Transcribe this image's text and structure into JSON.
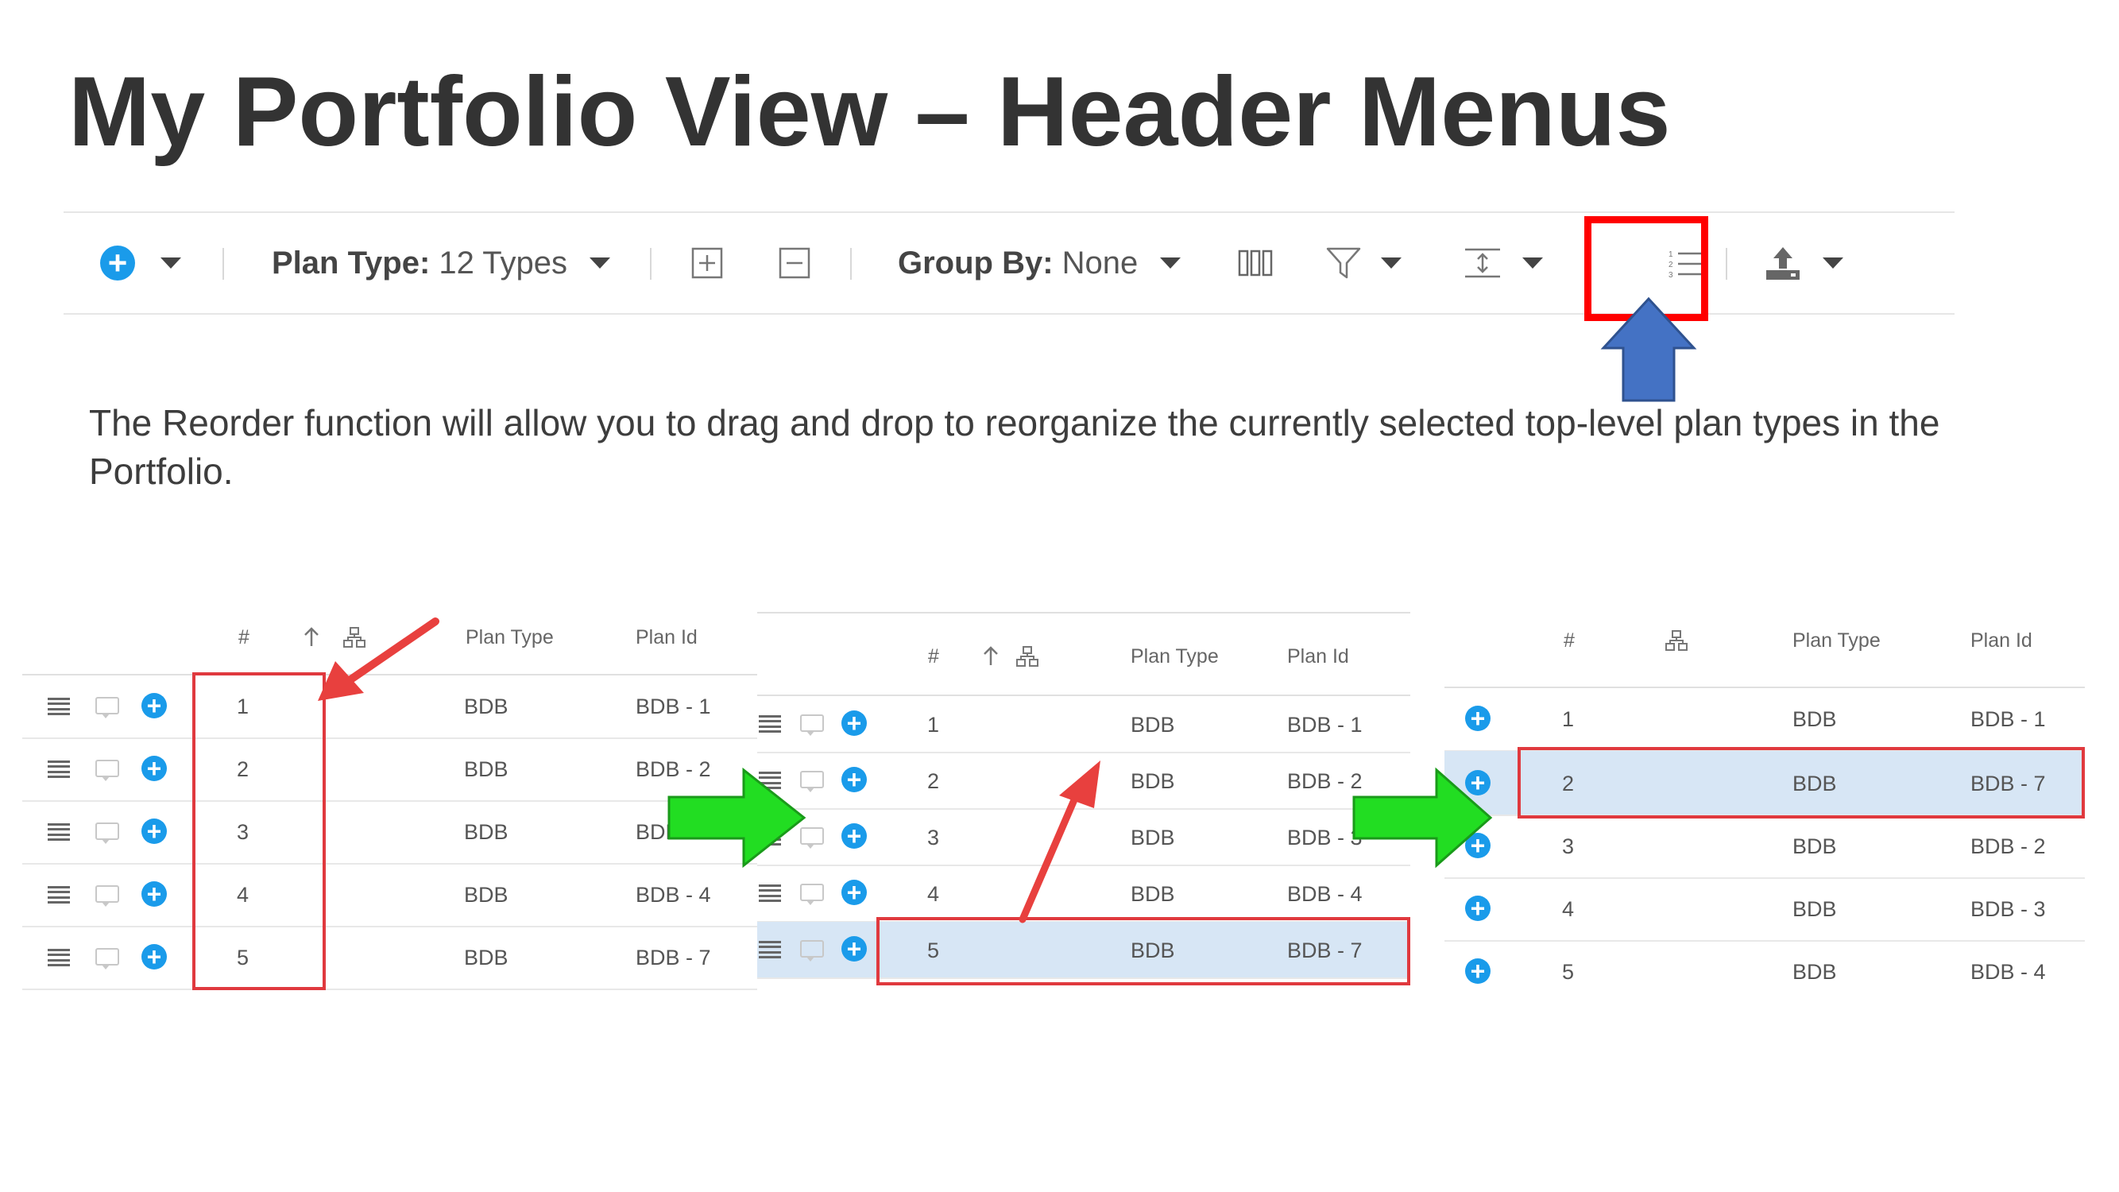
{
  "slide": {
    "title": "My Portfolio View – Header Menus",
    "description": "The Reorder function will allow you to drag and drop to reorganize the currently selected top-level plan types in the Portfolio."
  },
  "toolbar": {
    "plan_type_label": "Plan Type:",
    "plan_type_value": "12 Types",
    "group_by_label": "Group By:",
    "group_by_value": "None",
    "icons": [
      "add-icon",
      "expand-all-icon",
      "collapse-all-icon",
      "columns-icon",
      "filter-icon",
      "row-height-icon",
      "reorder-icon",
      "export-icon"
    ]
  },
  "tables": {
    "headers": {
      "num": "#",
      "plan_type": "Plan Type",
      "plan_id": "Plan Id"
    },
    "before": [
      {
        "n": "1",
        "type": "BDB",
        "id": "BDB - 1"
      },
      {
        "n": "2",
        "type": "BDB",
        "id": "BDB - 2"
      },
      {
        "n": "3",
        "type": "BDB",
        "id": "BDB - 3"
      },
      {
        "n": "4",
        "type": "BDB",
        "id": "BDB - 4"
      },
      {
        "n": "5",
        "type": "BDB",
        "id": "BDB - 7"
      }
    ],
    "dragging": [
      {
        "n": "1",
        "type": "BDB",
        "id": "BDB - 1"
      },
      {
        "n": "2",
        "type": "BDB",
        "id": "BDB - 2"
      },
      {
        "n": "3",
        "type": "BDB",
        "id": "BDB - 3"
      },
      {
        "n": "4",
        "type": "BDB",
        "id": "BDB - 4"
      },
      {
        "n": "5",
        "type": "BDB",
        "id": "BDB - 7"
      }
    ],
    "after": [
      {
        "n": "1",
        "type": "BDB",
        "id": "BDB - 1"
      },
      {
        "n": "2",
        "type": "BDB",
        "id": "BDB - 7"
      },
      {
        "n": "3",
        "type": "BDB",
        "id": "BDB - 2"
      },
      {
        "n": "4",
        "type": "BDB",
        "id": "BDB - 3"
      },
      {
        "n": "5",
        "type": "BDB",
        "id": "BDB - 4"
      }
    ]
  },
  "colors": {
    "highlight_box": "#ff0000",
    "callout_arrow": "#4472c4",
    "red_arrow": "#e8403e",
    "green_arrow": "#22dd22",
    "selected_row": "#d7e6f5"
  }
}
